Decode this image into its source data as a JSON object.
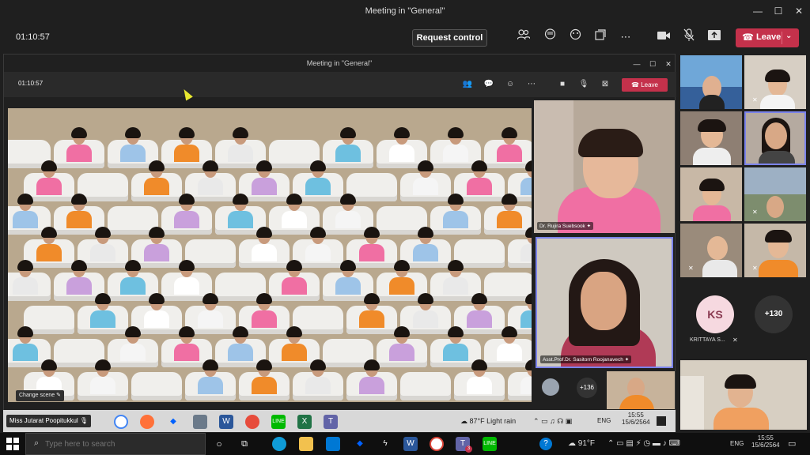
{
  "window": {
    "title": "Meeting in \"General\"",
    "minimize": "—",
    "maximize": "☐",
    "close": "✕"
  },
  "toolbar": {
    "timer": "01:10:57",
    "request_control": "Request control",
    "leave": "Leave"
  },
  "inner": {
    "title": "Meeting in \"General\"",
    "timer": "01:10:57",
    "leave": "Leave",
    "change_scene": "Change scene ✎"
  },
  "tiles": {
    "presenter1": "Dr. Rujira Suebsook",
    "presenter2": "Asst.Prof.Dr. Sasitorn Roojanavech",
    "more_inner": "+136"
  },
  "sidebar": {
    "avatar_initials": "KS",
    "avatar_name": "KRITTAYA S...",
    "more": "+130"
  },
  "inner_taskbar": {
    "presenter_name": "Miss Jutarat Poopitukkul",
    "weather": "87°F Light rain",
    "lang": "ENG",
    "time": "15:55",
    "date": "15/6/2564"
  },
  "taskbar": {
    "search_placeholder": "Type here to search",
    "weather": "91°F",
    "lang": "ENG",
    "time": "15:55",
    "date": "15/6/2564",
    "teams_badge": "3"
  },
  "colors": {
    "leave": "#c4314b",
    "teams_purple": "#6264a7",
    "highlight_border": "#7b83eb"
  }
}
